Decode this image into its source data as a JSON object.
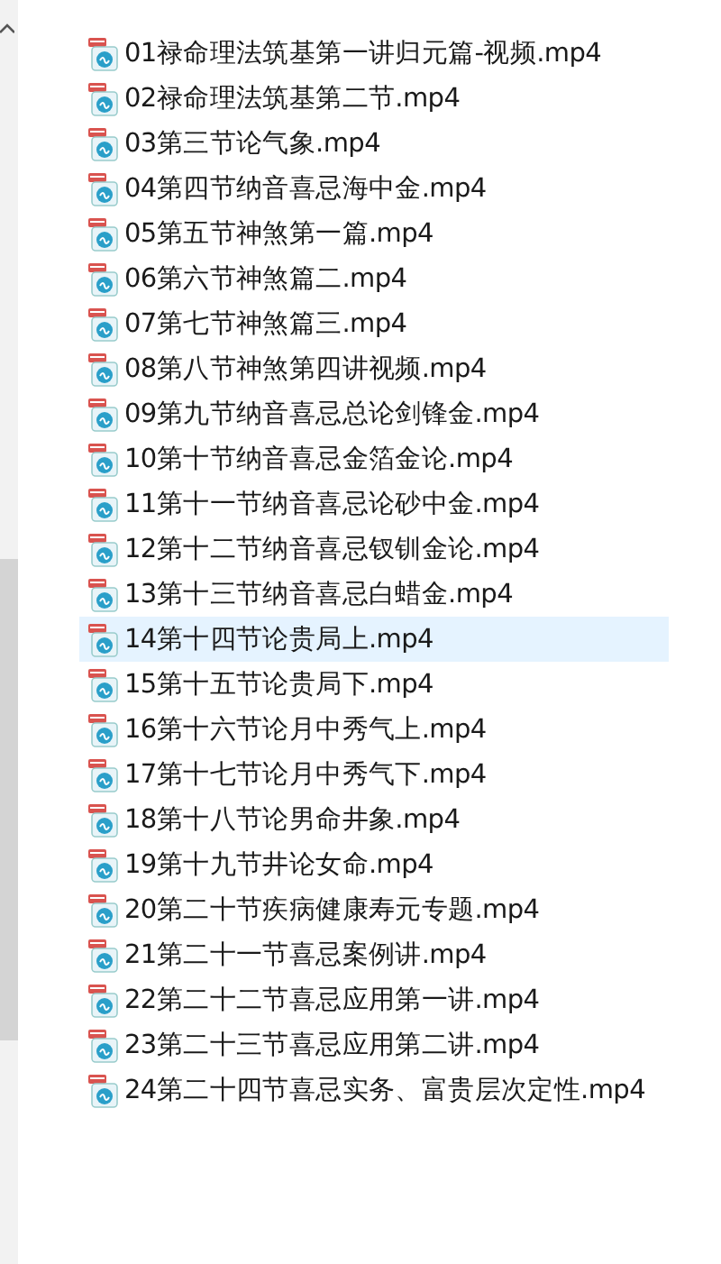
{
  "files": [
    {
      "name": "01禄命理法筑基第一讲归元篇-视频.mp4",
      "selected": false
    },
    {
      "name": "02禄命理法筑基第二节.mp4",
      "selected": false
    },
    {
      "name": "03第三节论气象.mp4",
      "selected": false
    },
    {
      "name": "04第四节纳音喜忌海中金.mp4",
      "selected": false
    },
    {
      "name": "05第五节神煞第一篇.mp4",
      "selected": false
    },
    {
      "name": "06第六节神煞篇二.mp4",
      "selected": false
    },
    {
      "name": "07第七节神煞篇三.mp4",
      "selected": false
    },
    {
      "name": "08第八节神煞第四讲视频.mp4",
      "selected": false
    },
    {
      "name": "09第九节纳音喜忌总论剑锋金.mp4",
      "selected": false
    },
    {
      "name": "10第十节纳音喜忌金箔金论.mp4",
      "selected": false
    },
    {
      "name": "11第十一节纳音喜忌论砂中金.mp4",
      "selected": false
    },
    {
      "name": "12第十二节纳音喜忌钗钏金论.mp4",
      "selected": false
    },
    {
      "name": "13第十三节纳音喜忌白蜡金.mp4",
      "selected": false
    },
    {
      "name": "14第十四节论贵局上.mp4",
      "selected": true
    },
    {
      "name": "15第十五节论贵局下.mp4",
      "selected": false
    },
    {
      "name": "16第十六节论月中秀气上.mp4",
      "selected": false
    },
    {
      "name": "17第十七节论月中秀气下.mp4",
      "selected": false
    },
    {
      "name": "18第十八节论男命井象.mp4",
      "selected": false
    },
    {
      "name": "19第十九节井论女命.mp4",
      "selected": false
    },
    {
      "name": "20第二十节疾病健康寿元专题.mp4",
      "selected": false
    },
    {
      "name": "21第二十一节喜忌案例讲.mp4",
      "selected": false
    },
    {
      "name": "22第二十二节喜忌应用第一讲.mp4",
      "selected": false
    },
    {
      "name": "23第二十三节喜忌应用第二讲.mp4",
      "selected": false
    },
    {
      "name": "24第二十四节喜忌实务、富贵层次定性.mp4",
      "selected": false
    }
  ]
}
